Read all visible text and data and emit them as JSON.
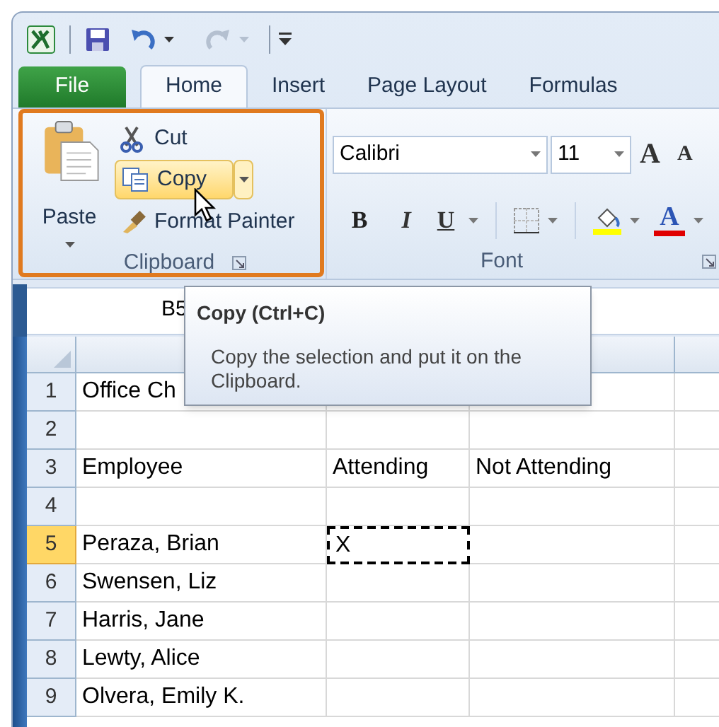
{
  "quick_access": [
    {
      "kind": "save",
      "disabled": false
    },
    {
      "kind": "undo",
      "disabled": false
    },
    {
      "kind": "redo",
      "disabled": true
    }
  ],
  "tabs": [
    {
      "label": "File",
      "kind": "file",
      "selected": false
    },
    {
      "label": "Home",
      "kind": "tab",
      "selected": true
    },
    {
      "label": "Insert",
      "kind": "tab",
      "selected": false
    },
    {
      "label": "Page Layout",
      "kind": "tab",
      "selected": false
    },
    {
      "label": "Formulas",
      "kind": "tab",
      "selected": false
    }
  ],
  "clipboard_group": {
    "label": "Clipboard",
    "highlighted": true,
    "paste": "Paste",
    "cut": "Cut",
    "copy": {
      "label": "Copy",
      "hovered": true
    },
    "format_painter": "Format Painter"
  },
  "font_group": {
    "label": "Font",
    "font_name": "Calibri",
    "font_size": "11",
    "grow_font": "A",
    "shrink_font": "A",
    "bold": "B",
    "italic": "I",
    "underline": "U",
    "font_color": "A"
  },
  "formula_bar": {
    "name_box": "B5"
  },
  "tooltip": {
    "title": "Copy (Ctrl+C)",
    "description": "Copy the selection and put it on the Clipboard."
  },
  "rows": [
    {
      "number": "1",
      "selected": false,
      "cells": [
        {
          "text": "Office Ch",
          "copied": false
        },
        {
          "copied": false
        },
        {
          "copied": false
        }
      ]
    },
    {
      "number": "2",
      "selected": false,
      "cells": [
        {
          "copied": false
        },
        {
          "copied": false
        },
        {
          "copied": false
        }
      ]
    },
    {
      "number": "3",
      "selected": false,
      "cells": [
        {
          "text": "Employee",
          "copied": false
        },
        {
          "text": "Attending",
          "copied": false
        },
        {
          "text": "Not Attending",
          "copied": false
        }
      ]
    },
    {
      "number": "4",
      "selected": false,
      "cells": [
        {
          "copied": false
        },
        {
          "copied": false
        },
        {
          "copied": false
        }
      ]
    },
    {
      "number": "5",
      "selected": true,
      "cells": [
        {
          "text": "Peraza, Brian",
          "copied": false
        },
        {
          "text": "X",
          "copied": true
        },
        {
          "copied": false
        }
      ]
    },
    {
      "number": "6",
      "selected": false,
      "cells": [
        {
          "text": "Swensen, Liz",
          "copied": false
        },
        {
          "copied": false
        },
        {
          "copied": false
        }
      ]
    },
    {
      "number": "7",
      "selected": false,
      "cells": [
        {
          "text": "Harris, Jane",
          "copied": false
        },
        {
          "copied": false
        },
        {
          "copied": false
        }
      ]
    },
    {
      "number": "8",
      "selected": false,
      "cells": [
        {
          "text": "Lewty, Alice",
          "copied": false
        },
        {
          "copied": false
        },
        {
          "copied": false
        }
      ]
    },
    {
      "number": "9",
      "selected": false,
      "cells": [
        {
          "text": "Olvera, Emily K.",
          "copied": false
        },
        {
          "copied": false
        },
        {
          "copied": false
        }
      ]
    }
  ]
}
